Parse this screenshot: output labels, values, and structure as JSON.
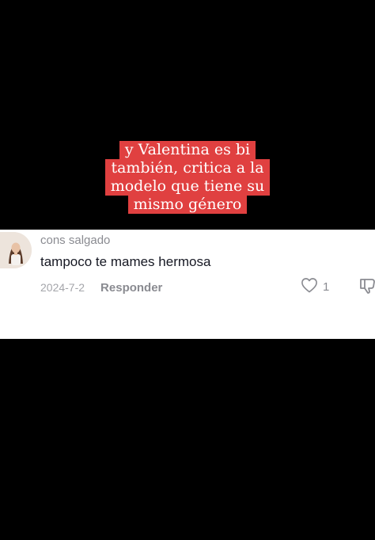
{
  "video": {
    "caption_lines": [
      "y Valentina es bi",
      "también, critica a la",
      "modelo que tiene su",
      "mismo género"
    ],
    "caption_bg_color": "#e04040"
  },
  "comment": {
    "username": "cons salgado",
    "text": "tampoco te mames hermosa",
    "date": "2024-7-2",
    "reply_label": "Responder",
    "like_count": "1",
    "icons": [
      "avatar",
      "heart-icon",
      "dislike-icon"
    ]
  }
}
